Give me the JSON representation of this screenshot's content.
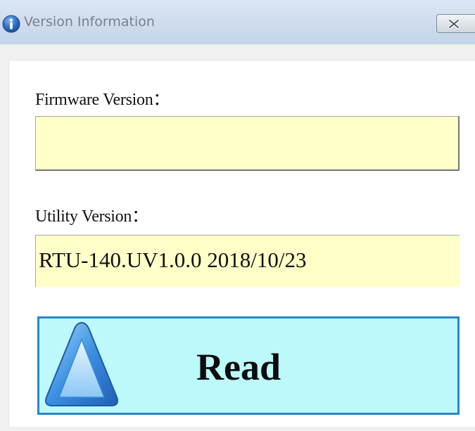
{
  "window": {
    "title": "Version Information"
  },
  "firmware": {
    "label": "Firmware Version：",
    "value": ""
  },
  "utility": {
    "label": "Utility Version：",
    "value": "RTU-140.UV1.0.0 2018/10/23"
  },
  "read_button": {
    "label": "Read",
    "icon": "up-triangle-icon"
  },
  "colors": {
    "field_background": "#ffffc8",
    "button_background": "#bdf8fb",
    "button_border": "#2a86c8"
  }
}
